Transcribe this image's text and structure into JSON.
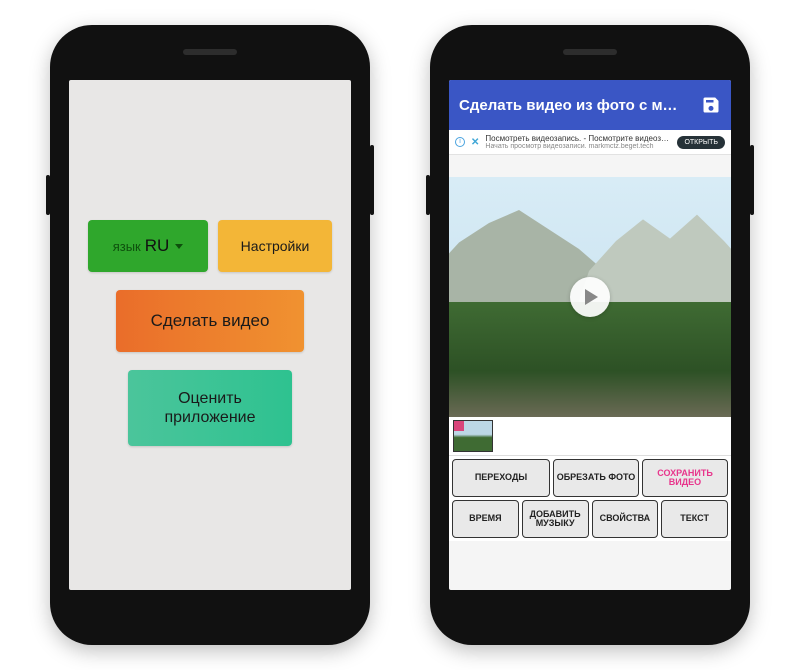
{
  "left": {
    "lang_prefix": "язык",
    "lang_code": "RU",
    "settings": "Настройки",
    "make_video": "Сделать видео",
    "rate_app": "Оценить приложение"
  },
  "right": {
    "appbar_title": "Сделать видео из фото с му…",
    "ad": {
      "title": "Посмотреть видеозапись. - Посмотрите видеозапись.",
      "subtitle": "Начать просмотр видеозаписи. markmctz.beget.tech",
      "cta": "ОТКРЫТЬ"
    },
    "tools_row1": [
      "ПЕРЕХОДЫ",
      "ОБРЕЗАТЬ ФОТО",
      "СОХРАНИТЬ ВИДЕО"
    ],
    "tools_row2": [
      "ВРЕМЯ",
      "ДОБАВИТЬ МУЗЫКУ",
      "СВОЙСТВА",
      "ТЕКСТ"
    ]
  }
}
